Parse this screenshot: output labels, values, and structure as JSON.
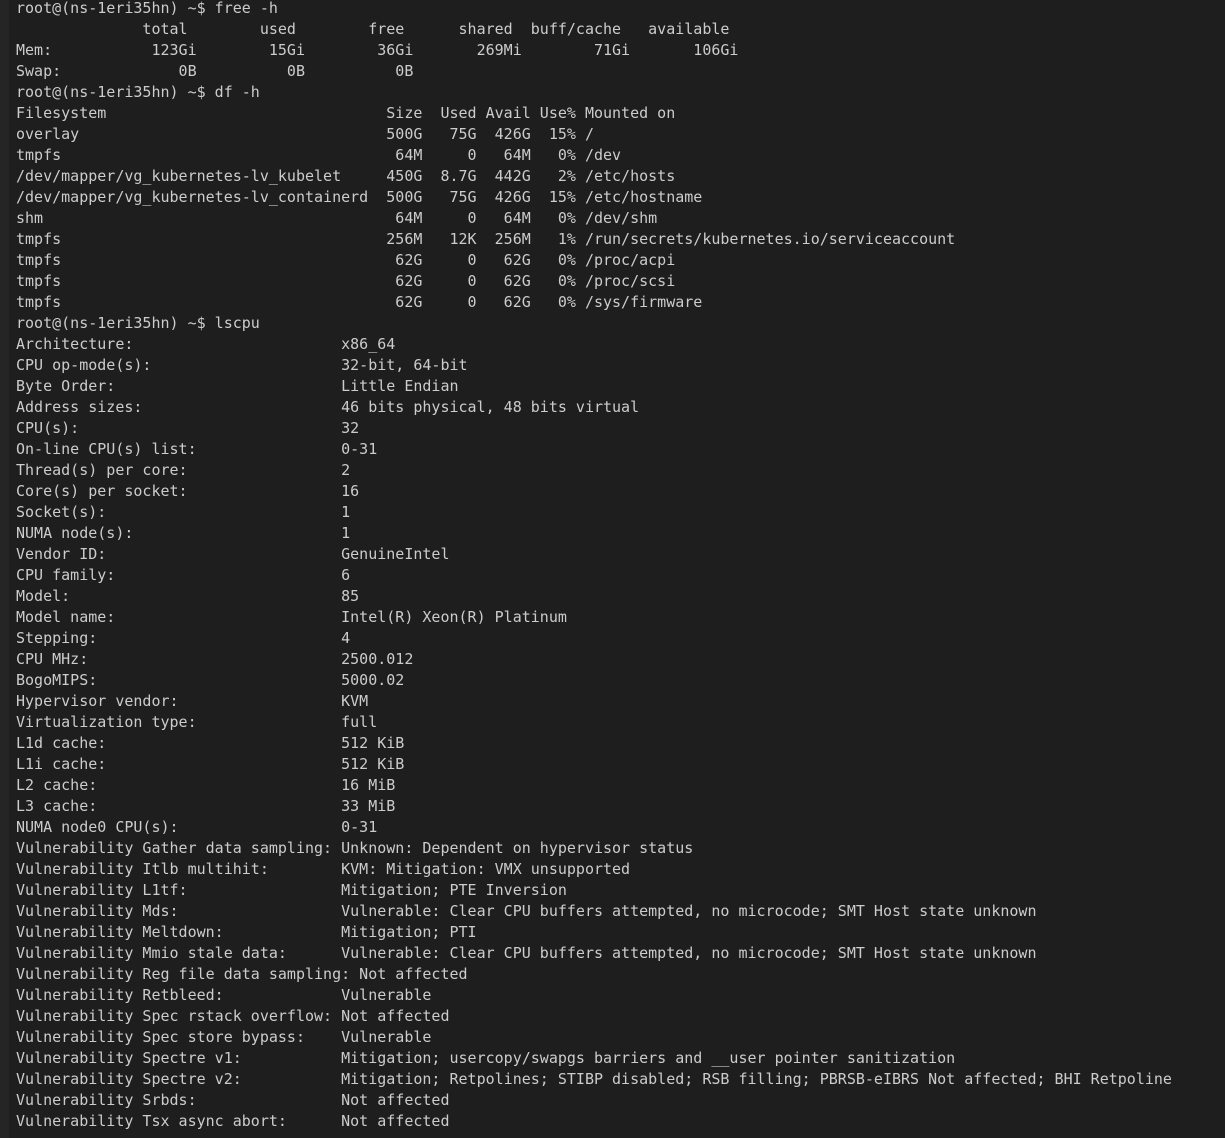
{
  "terminal": {
    "lines": [
      "root@(ns-1eri35hn) ~$ free -h",
      "              total        used        free      shared  buff/cache   available",
      "Mem:           123Gi        15Gi        36Gi       269Mi        71Gi       106Gi",
      "Swap:             0B          0B          0B",
      "root@(ns-1eri35hn) ~$ df -h",
      "Filesystem                               Size  Used Avail Use% Mounted on",
      "overlay                                  500G   75G  426G  15% /",
      "tmpfs                                     64M     0   64M   0% /dev",
      "/dev/mapper/vg_kubernetes-lv_kubelet     450G  8.7G  442G   2% /etc/hosts",
      "/dev/mapper/vg_kubernetes-lv_containerd  500G   75G  426G  15% /etc/hostname",
      "shm                                       64M     0   64M   0% /dev/shm",
      "tmpfs                                    256M   12K  256M   1% /run/secrets/kubernetes.io/serviceaccount",
      "tmpfs                                     62G     0   62G   0% /proc/acpi",
      "tmpfs                                     62G     0   62G   0% /proc/scsi",
      "tmpfs                                     62G     0   62G   0% /sys/firmware",
      "root@(ns-1eri35hn) ~$ lscpu",
      "Architecture:                       x86_64",
      "CPU op-mode(s):                     32-bit, 64-bit",
      "Byte Order:                         Little Endian",
      "Address sizes:                      46 bits physical, 48 bits virtual",
      "CPU(s):                             32",
      "On-line CPU(s) list:                0-31",
      "Thread(s) per core:                 2",
      "Core(s) per socket:                 16",
      "Socket(s):                          1",
      "NUMA node(s):                       1",
      "Vendor ID:                          GenuineIntel",
      "CPU family:                         6",
      "Model:                              85",
      "Model name:                         Intel(R) Xeon(R) Platinum",
      "Stepping:                           4",
      "CPU MHz:                            2500.012",
      "BogoMIPS:                           5000.02",
      "Hypervisor vendor:                  KVM",
      "Virtualization type:                full",
      "L1d cache:                          512 KiB",
      "L1i cache:                          512 KiB",
      "L2 cache:                           16 MiB",
      "L3 cache:                           33 MiB",
      "NUMA node0 CPU(s):                  0-31",
      "Vulnerability Gather data sampling: Unknown: Dependent on hypervisor status",
      "Vulnerability Itlb multihit:        KVM: Mitigation: VMX unsupported",
      "Vulnerability L1tf:                 Mitigation; PTE Inversion",
      "Vulnerability Mds:                  Vulnerable: Clear CPU buffers attempted, no microcode; SMT Host state unknown",
      "Vulnerability Meltdown:             Mitigation; PTI",
      "Vulnerability Mmio stale data:      Vulnerable: Clear CPU buffers attempted, no microcode; SMT Host state unknown",
      "Vulnerability Reg file data sampling: Not affected",
      "Vulnerability Retbleed:             Vulnerable",
      "Vulnerability Spec rstack overflow: Not affected",
      "Vulnerability Spec store bypass:    Vulnerable",
      "Vulnerability Spectre v1:           Mitigation; usercopy/swapgs barriers and __user pointer sanitization",
      "Vulnerability Spectre v2:           Mitigation; Retpolines; STIBP disabled; RSB filling; PBRSB-eIBRS Not affected; BHI Retpoline",
      "Vulnerability Srbds:                Not affected",
      "Vulnerability Tsx async abort:      Not affected"
    ]
  }
}
